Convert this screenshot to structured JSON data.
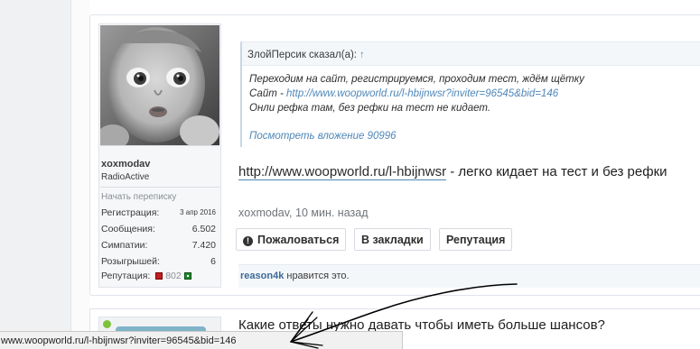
{
  "user": {
    "name": "xoxmodav",
    "title": "RadioActive",
    "start_conversation": "Начать переписку",
    "stats": [
      {
        "label": "Регистрация:",
        "value": "3 апр 2016"
      },
      {
        "label": "Сообщения:",
        "value": "6.502"
      },
      {
        "label": "Симпатии:",
        "value": "7.420"
      },
      {
        "label": "Розыгрышей:",
        "value": "6"
      }
    ],
    "reputation_label": "Репутация:",
    "reputation_value": "802"
  },
  "quote": {
    "author_line": "ЗлойПерсик сказал(а):",
    "up_arrow": "↑",
    "line1": "Переходим на сайт, регистрируемся, проходим тест, ждём щётку",
    "line2_prefix": "Сайт - ",
    "line2_link": "http://www.woopworld.ru/l-hbijnwsr?inviter=96545&bid=146",
    "line3": "Онли рефка там, без рефки на тест не кидает.",
    "attachment_link": "Посмотреть вложение 90996"
  },
  "message": {
    "url": "http://www.woopworld.ru/l-hbijnwsr",
    "suffix": " - легко кидает на тест и без рефки"
  },
  "meta": "xoxmodav, 10 мин. назад",
  "actions": {
    "report": "Пожаловаться",
    "bookmark": "В закладки",
    "reputation": "Репутация"
  },
  "likes": {
    "user": "reason4k",
    "text": " нравится это."
  },
  "next_post": {
    "text": "Какие ответы нужно давать чтобы иметь больше шансов?"
  },
  "status_bar": {
    "url": "www.woopworld.ru/l-hbijnwsr?inviter=96545&bid=146"
  },
  "colors": {
    "link": "#4f87b8",
    "rep_negative": "#c02020",
    "rep_positive": "#1e8a2e"
  }
}
